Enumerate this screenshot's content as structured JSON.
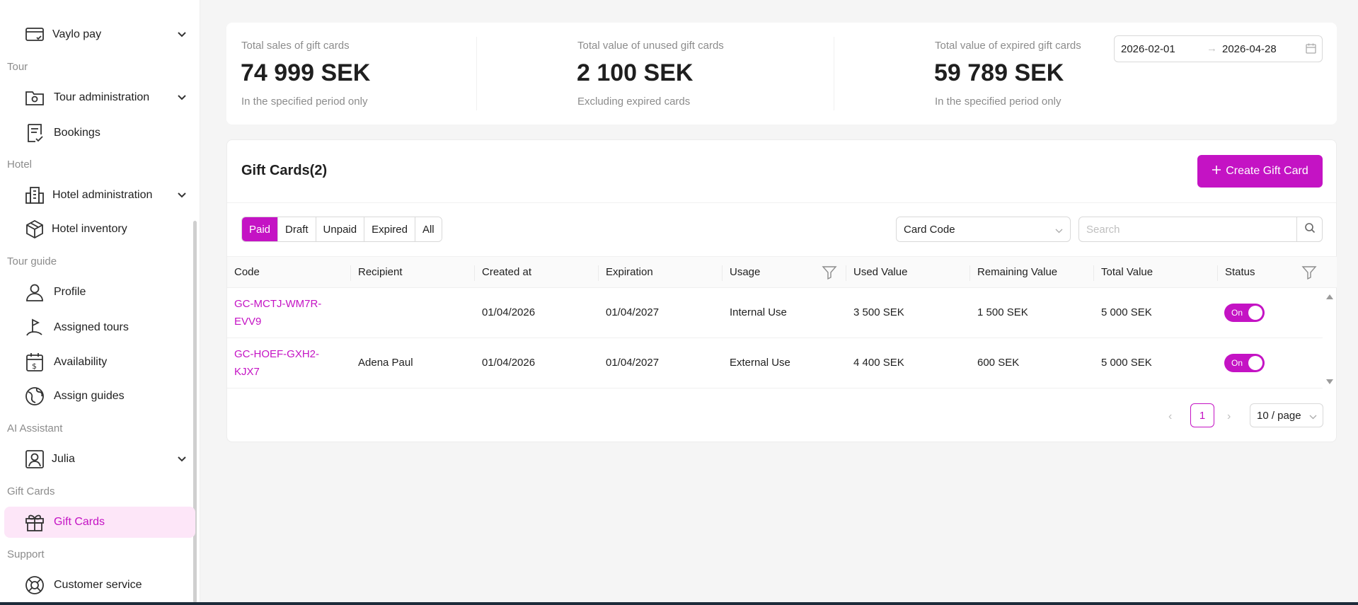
{
  "sidebar": {
    "groups": {
      "tour": "Tour",
      "hotel": "Hotel",
      "tour_guide": "Tour guide",
      "ai_assistant": "AI Assistant",
      "gift_cards": "Gift Cards",
      "support": "Support"
    },
    "items": {
      "vaylo_pay": "Vaylo pay",
      "tour_administration": "Tour administration",
      "bookings": "Bookings",
      "hotel_administration": "Hotel administration",
      "hotel_inventory": "Hotel inventory",
      "profile": "Profile",
      "assigned_tours": "Assigned tours",
      "availability": "Availability",
      "assign_guides": "Assign guides",
      "julia": "Julia",
      "gift_cards": "Gift Cards",
      "customer_service": "Customer service"
    },
    "active_item": "gift_cards"
  },
  "stats": {
    "sales": {
      "title": "Total sales of gift cards",
      "value": "74 999 SEK",
      "sub": "In the specified period only"
    },
    "unused": {
      "title": "Total value of unused gift cards",
      "value": "2 100 SEK",
      "sub": "Excluding expired cards"
    },
    "expired": {
      "title": "Total value of expired gift cards",
      "value": "59 789 SEK",
      "sub": "In the specified period only"
    },
    "date_from": "2026-02-01",
    "date_to": "2026-04-28"
  },
  "card": {
    "title": "Gift Cards(2)",
    "create_label": "Create Gift Card",
    "filters": [
      "Paid",
      "Draft",
      "Unpaid",
      "Expired",
      "All"
    ],
    "selected_filter": "Paid",
    "search_field_select": "Card Code",
    "search_placeholder": "Search"
  },
  "table": {
    "columns": {
      "code": "Code",
      "recipient": "Recipient",
      "created_at": "Created at",
      "expiration": "Expiration",
      "usage": "Usage",
      "used_value": "Used Value",
      "remaining_value": "Remaining Value",
      "total_value": "Total Value",
      "status": "Status"
    },
    "rows": [
      {
        "code": "GC-MCTJ-WM7R-EVV9",
        "recipient": "",
        "created_at": "01/04/2026",
        "expiration": "01/04/2027",
        "usage": "Internal Use",
        "used_value": "3 500 SEK",
        "remaining_value": "1 500 SEK",
        "total_value": "5 000 SEK",
        "status": "On"
      },
      {
        "code": "GC-HOEF-GXH2-KJX7",
        "recipient": "Adena Paul",
        "created_at": "01/04/2026",
        "expiration": "01/04/2027",
        "usage": "External Use",
        "used_value": "4 400 SEK",
        "remaining_value": "600 SEK",
        "total_value": "5 000 SEK",
        "status": "On"
      }
    ]
  },
  "pagination": {
    "current_page": "1",
    "page_size": "10 / page"
  },
  "colors": {
    "accent": "#c413c4",
    "active_bg": "#fde6f8"
  }
}
